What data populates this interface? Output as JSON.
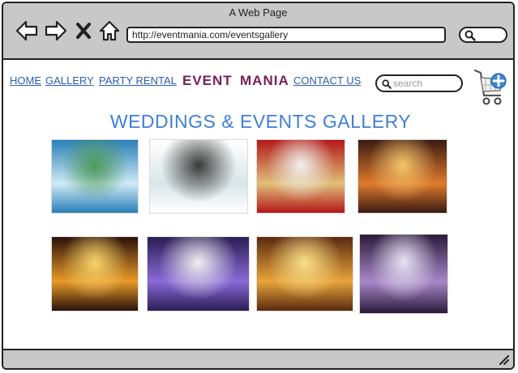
{
  "window": {
    "title": "A Web Page",
    "url": "http://eventmania.com/eventsgallery"
  },
  "nav": {
    "links": [
      "HOME",
      "GALLERY",
      "PARTY RENTAL",
      "CONTACT US"
    ],
    "brand_event": "EVENT",
    "brand_mania": "MANIA",
    "search_placeholder": "search"
  },
  "gallery": {
    "heading": "WEDDINGS & EVENTS GALLERY",
    "images": [
      {
        "name": "wedding-image-blue-drapes",
        "colors": [
          "#2a7fb8",
          "#cfeaf5",
          "#4f9a5a"
        ]
      },
      {
        "name": "wedding-image-white-aisle",
        "colors": [
          "#ffffff",
          "#d9e6e8",
          "#3a3a3a"
        ]
      },
      {
        "name": "wedding-image-red-mandap",
        "colors": [
          "#b31818",
          "#e0c07a",
          "#f0f0f0"
        ]
      },
      {
        "name": "wedding-image-orange-mandap",
        "colors": [
          "#3a1a12",
          "#e07a2c",
          "#f3c46a"
        ]
      },
      {
        "name": "wedding-image-gold-stage",
        "colors": [
          "#2a120a",
          "#e89a28",
          "#f7d26a"
        ]
      },
      {
        "name": "wedding-image-purple-stage",
        "colors": [
          "#2a1d55",
          "#8a6ad8",
          "#f0f0f0"
        ]
      },
      {
        "name": "wedding-image-golden-canopy",
        "colors": [
          "#5a2a10",
          "#e8a43a",
          "#fae08a"
        ]
      },
      {
        "name": "wedding-image-crystal-hall",
        "colors": [
          "#2a1a3a",
          "#a888c8",
          "#e8e4f4"
        ]
      }
    ]
  },
  "colors": {
    "link": "#2a5db0",
    "brand": "#7a1f55",
    "heading": "#3f7fd8",
    "chrome": "#c8c8c8"
  }
}
